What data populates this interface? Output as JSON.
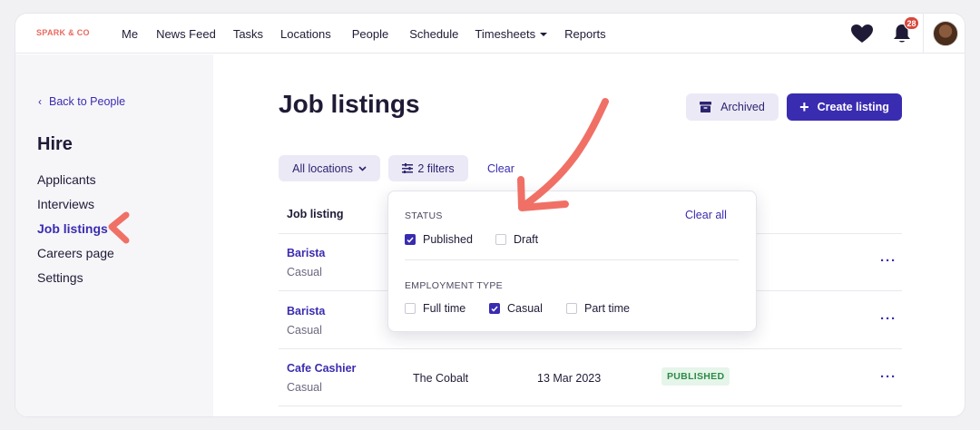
{
  "brand": "SPARK & CO",
  "nav": {
    "items": [
      "Me",
      "News Feed",
      "Tasks",
      "Locations",
      "People",
      "Schedule",
      "Timesheets",
      "Reports"
    ],
    "notifications_count": "28"
  },
  "sidebar": {
    "back_label": "Back to People",
    "section_title": "Hire",
    "items": [
      "Applicants",
      "Interviews",
      "Job listings",
      "Careers page",
      "Settings"
    ],
    "active_item": "Job listings"
  },
  "page": {
    "title": "Job listings",
    "archived_label": "Archived",
    "create_label": "Create listing"
  },
  "filters": {
    "locations_label": "All locations",
    "filters_label": "2 filters",
    "clear_label": "Clear"
  },
  "table": {
    "header_job": "Job listing",
    "rows": [
      {
        "name": "Barista",
        "type": "Casual",
        "location": "",
        "date": "",
        "status": ""
      },
      {
        "name": "Barista",
        "type": "Casual",
        "location": "",
        "date": "",
        "status": ""
      },
      {
        "name": "Cafe Cashier",
        "type": "Casual",
        "location": "The Cobalt",
        "date": "13 Mar 2023",
        "status": "PUBLISHED"
      }
    ]
  },
  "filter_dropdown": {
    "clear_all_label": "Clear all",
    "status_heading": "STATUS",
    "status_options": [
      {
        "label": "Published",
        "checked": true
      },
      {
        "label": "Draft",
        "checked": false
      }
    ],
    "employment_heading": "EMPLOYMENT TYPE",
    "employment_options": [
      {
        "label": "Full time",
        "checked": false
      },
      {
        "label": "Casual",
        "checked": true
      },
      {
        "label": "Part time",
        "checked": false
      }
    ]
  },
  "colors": {
    "accent": "#3a2cb0",
    "brand": "#e86a5e",
    "annotation": "#f07066",
    "published": "#2d8a46"
  },
  "icons": [
    "heart-icon",
    "bell-icon",
    "archive-icon",
    "filter-sliders-icon",
    "chevron-down-icon",
    "chevron-left-icon",
    "checkbox-icon",
    "more-options-icon"
  ]
}
